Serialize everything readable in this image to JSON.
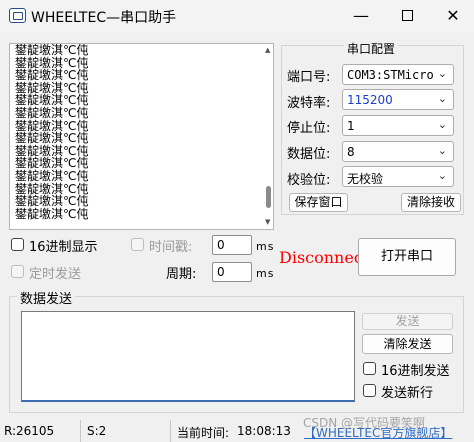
{
  "window": {
    "title": "WHEELTEC—串口助手",
    "minimize": "—",
    "close": "✕"
  },
  "receive": {
    "lines": [
      "鐢靛墽淇℃伅",
      "鐢靛墽淇℃伅",
      "鐢靛墽淇℃伅",
      "鐢靛墽淇℃伅",
      "鐢靛墽淇℃伅",
      "鐢靛墽淇℃伅",
      "鐢靛墽淇℃伅",
      "鐢靛墽淇℃伅",
      "鐢靛墽淇℃伅",
      "鐢靛墽淇℃伅",
      "鐢靛墽淇℃伅",
      "鐢靛墽淇℃伅",
      "鐢靛墽淇℃伅",
      "鐢靛墽淇℃伅"
    ]
  },
  "config": {
    "title": "串口配置",
    "port_label": "端口号:",
    "port_value": "COM3:STMicro",
    "baud_label": "波特率:",
    "baud_value": "115200",
    "stop_label": "停止位:",
    "stop_value": "1",
    "data_label": "数据位:",
    "data_value": "8",
    "parity_label": "校验位:",
    "parity_value": "无校验",
    "save_button": "保存窗口",
    "clear_recv_button": "清除接收"
  },
  "options": {
    "hex_display": "16进制显示",
    "timestamp": "时间戳:",
    "timestamp_value": "0",
    "timed_send": "定时发送",
    "period": "周期:",
    "period_value": "0",
    "unit": "ms"
  },
  "connection": {
    "status": "Disconnec",
    "open_button": "打开串口"
  },
  "send": {
    "title": "数据发送",
    "send_button": "发送",
    "clear_send_button": "清除发送",
    "hex_send": "16进制发送",
    "send_newline": "发送新行"
  },
  "statusbar": {
    "received": "R:26105",
    "sent": "S:2",
    "time_label": "当前时间:",
    "time_value": "18:08:13",
    "store_link": "【WHEELTEC官方旗舰店】",
    "watermark": "CSDN @写代码要笑啊"
  },
  "colors": {
    "status_error": "#ff0000",
    "link": "#2f6cc6",
    "focus_border": "#3c6bb0"
  }
}
